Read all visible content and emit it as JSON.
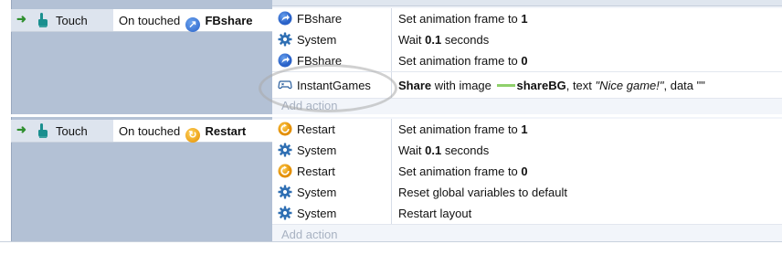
{
  "events": [
    {
      "condition": {
        "name": "Touch",
        "description_prefix": "On touched",
        "object": "FBshare",
        "object_icon": "fbshare-icon"
      },
      "actions": [
        {
          "object": "FBshare",
          "icon": "fbshare-icon",
          "parts": [
            {
              "t": "Set animation frame to "
            },
            {
              "t": "1",
              "b": true
            }
          ]
        },
        {
          "object": "System",
          "icon": "gear-icon",
          "parts": [
            {
              "t": "Wait "
            },
            {
              "t": "0.1",
              "b": true
            },
            {
              "t": " seconds"
            }
          ]
        },
        {
          "object": "FBshare",
          "icon": "fbshare-icon",
          "parts": [
            {
              "t": "Set animation frame to "
            },
            {
              "t": "0",
              "b": true
            }
          ]
        },
        {
          "object": "InstantGames",
          "icon": "gamepad-icon",
          "parts": [
            {
              "t": "Share",
              "b": true
            },
            {
              "t": " with image "
            },
            {
              "t": "shareBG",
              "b": true,
              "pre_swatch": true
            },
            {
              "t": ", text "
            },
            {
              "t": "\"Nice game!\"",
              "i": true
            },
            {
              "t": ", data \"\""
            }
          ]
        }
      ],
      "add_action_label": "Add action"
    },
    {
      "condition": {
        "name": "Touch",
        "description_prefix": "On touched",
        "object": "Restart",
        "object_icon": "restart-icon"
      },
      "actions": [
        {
          "object": "Restart",
          "icon": "restart-icon",
          "parts": [
            {
              "t": "Set animation frame to "
            },
            {
              "t": "1",
              "b": true
            }
          ]
        },
        {
          "object": "System",
          "icon": "gear-icon",
          "parts": [
            {
              "t": "Wait "
            },
            {
              "t": "0.1",
              "b": true
            },
            {
              "t": " seconds"
            }
          ]
        },
        {
          "object": "Restart",
          "icon": "restart-icon",
          "parts": [
            {
              "t": "Set animation frame to "
            },
            {
              "t": "0",
              "b": true
            }
          ]
        },
        {
          "object": "System",
          "icon": "gear-icon",
          "parts": [
            {
              "t": "Reset global variables to default"
            }
          ]
        },
        {
          "object": "System",
          "icon": "gear-icon",
          "parts": [
            {
              "t": "Restart layout"
            }
          ]
        }
      ],
      "add_action_label": "Add action"
    }
  ],
  "colors": {
    "condition_panel": "#b3c1d5",
    "condition_row": "#dde4ee",
    "action_panel": "#f2f5fa",
    "add_action_text": "#a8b2c2",
    "fbshare_icon": "#2a62c8",
    "restart_icon": "#e38e00",
    "system_gear": "#2f6fb3",
    "touch_icon": "#1a8f8f",
    "arrow": "#2f8f2f",
    "image_swatch": "#8fd06b"
  }
}
